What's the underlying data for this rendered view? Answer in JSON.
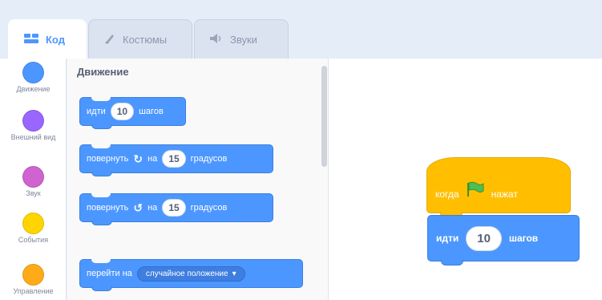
{
  "tabs": [
    {
      "label": "Код",
      "icon": "code-icon",
      "active": true
    },
    {
      "label": "Костюмы",
      "icon": "brush-icon",
      "active": false
    },
    {
      "label": "Звуки",
      "icon": "speaker-icon",
      "active": false
    }
  ],
  "categories": [
    {
      "label": "Движение",
      "color": "#4c97ff"
    },
    {
      "label": "Внешний вид",
      "color": "#9966ff"
    },
    {
      "label": "Звук",
      "color": "#cf63cf"
    },
    {
      "label": "События",
      "color": "#ffd500"
    },
    {
      "label": "Управление",
      "color": "#ffab19"
    }
  ],
  "palette": {
    "title": "Движение",
    "blocks": {
      "move": {
        "prefix": "идти",
        "value": "10",
        "suffix": "шагов"
      },
      "turn_right": {
        "prefix": "повернуть",
        "icon": "↻",
        "mid": "на",
        "value": "15",
        "suffix": "градусов"
      },
      "turn_left": {
        "prefix": "повернуть",
        "icon": "↺",
        "mid": "на",
        "value": "15",
        "suffix": "градусов"
      },
      "goto": {
        "prefix": "перейти на",
        "option": "случайное положение"
      }
    }
  },
  "workspace": {
    "hat": {
      "prefix": "когда",
      "flag": "green-flag-icon",
      "suffix": "нажат"
    },
    "move": {
      "prefix": "идти",
      "value": "10",
      "suffix": "шагов"
    }
  },
  "colors": {
    "motion": "#4c97ff",
    "events": "#ffbf00",
    "accent": "#4c97ff"
  }
}
